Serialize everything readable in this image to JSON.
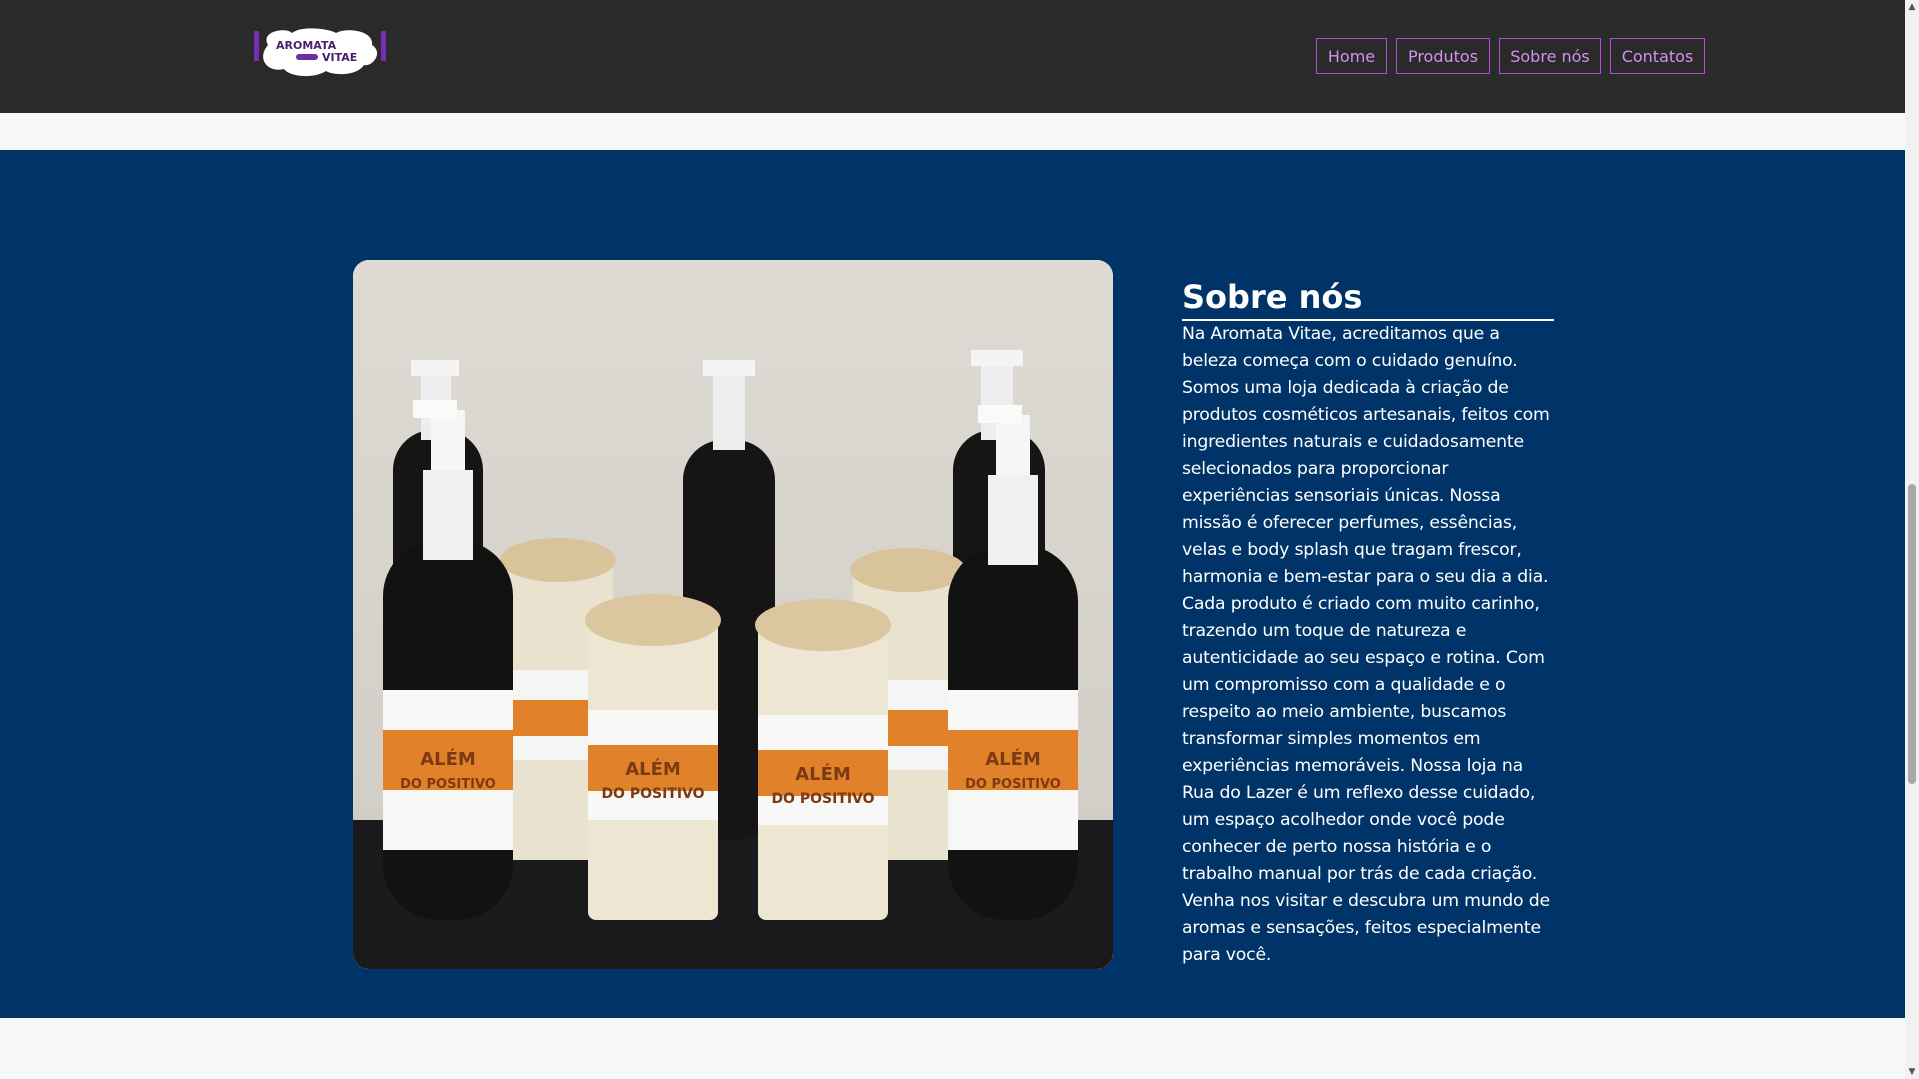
{
  "header": {
    "logo": {
      "line1": "AROMATA",
      "line2": "VITAE"
    },
    "nav": [
      {
        "label": "Home"
      },
      {
        "label": "Produtos"
      },
      {
        "label": "Sobre nós"
      },
      {
        "label": "Contatos"
      }
    ]
  },
  "about": {
    "title": "Sobre nós",
    "text": "Na Aromata Vitae, acreditamos que a beleza começa com o cuidado genuíno. Somos uma loja dedicada à criação de produtos cosméticos artesanais, feitos com ingredientes naturais e cuidadosamente selecionados para proporcionar experiências sensoriais únicas. Nossa missão é oferecer perfumes, essências, velas e body splash que tragam frescor, harmonia e bem-estar para o seu dia a dia. Cada produto é criado com muito carinho, trazendo um toque de natureza e autenticidade ao seu espaço e rotina. Com um compromisso com a qualidade e o respeito ao meio ambiente, buscamos transformar simples momentos em experiências memoráveis. Nossa loja na Rua do Lazer é um reflexo desse cuidado, um espaço acolhedor onde você pode conhecer de perto nossa história e o trabalho manual por trás de cada criação. Venha nos visitar e descubra um mundo de aromas e sensações, feitos especialmente para você.",
    "label_text": {
      "line1": "ALÉM",
      "line2": "DO POSITIVO"
    }
  },
  "colors": {
    "header_bg": "#2a2a2a",
    "section_bg": "#003468",
    "nav_accent": "#b24bd6"
  }
}
